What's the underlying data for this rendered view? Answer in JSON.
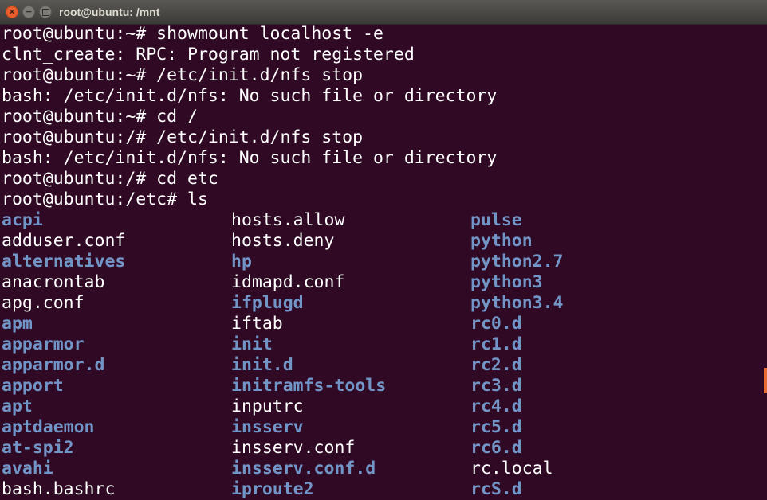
{
  "window": {
    "title": "root@ubuntu: /mnt",
    "close_glyph": "×",
    "min_glyph": "−"
  },
  "terminal": {
    "lines": [
      "root@ubuntu:~# showmount localhost -e",
      "clnt_create: RPC: Program not registered",
      "root@ubuntu:~# /etc/init.d/nfs stop",
      "bash: /etc/init.d/nfs: No such file or directory",
      "root@ubuntu:~# cd /",
      "root@ubuntu:/# /etc/init.d/nfs stop",
      "bash: /etc/init.d/nfs: No such file or directory",
      "root@ubuntu:/# cd etc",
      "root@ubuntu:/etc# ls"
    ],
    "listing": [
      [
        {
          "name": "acpi",
          "dir": true
        },
        {
          "name": "hosts.allow",
          "dir": false
        },
        {
          "name": "pulse",
          "dir": true
        }
      ],
      [
        {
          "name": "adduser.conf",
          "dir": false
        },
        {
          "name": "hosts.deny",
          "dir": false
        },
        {
          "name": "python",
          "dir": true
        }
      ],
      [
        {
          "name": "alternatives",
          "dir": true
        },
        {
          "name": "hp",
          "dir": true
        },
        {
          "name": "python2.7",
          "dir": true
        }
      ],
      [
        {
          "name": "anacrontab",
          "dir": false
        },
        {
          "name": "idmapd.conf",
          "dir": false
        },
        {
          "name": "python3",
          "dir": true
        }
      ],
      [
        {
          "name": "apg.conf",
          "dir": false
        },
        {
          "name": "ifplugd",
          "dir": true
        },
        {
          "name": "python3.4",
          "dir": true
        }
      ],
      [
        {
          "name": "apm",
          "dir": true
        },
        {
          "name": "iftab",
          "dir": false
        },
        {
          "name": "rc0.d",
          "dir": true
        }
      ],
      [
        {
          "name": "apparmor",
          "dir": true
        },
        {
          "name": "init",
          "dir": true
        },
        {
          "name": "rc1.d",
          "dir": true
        }
      ],
      [
        {
          "name": "apparmor.d",
          "dir": true
        },
        {
          "name": "init.d",
          "dir": true
        },
        {
          "name": "rc2.d",
          "dir": true
        }
      ],
      [
        {
          "name": "apport",
          "dir": true
        },
        {
          "name": "initramfs-tools",
          "dir": true
        },
        {
          "name": "rc3.d",
          "dir": true
        }
      ],
      [
        {
          "name": "apt",
          "dir": true
        },
        {
          "name": "inputrc",
          "dir": false
        },
        {
          "name": "rc4.d",
          "dir": true
        }
      ],
      [
        {
          "name": "aptdaemon",
          "dir": true
        },
        {
          "name": "insserv",
          "dir": true
        },
        {
          "name": "rc5.d",
          "dir": true
        }
      ],
      [
        {
          "name": "at-spi2",
          "dir": true
        },
        {
          "name": "insserv.conf",
          "dir": false
        },
        {
          "name": "rc6.d",
          "dir": true
        }
      ],
      [
        {
          "name": "avahi",
          "dir": true
        },
        {
          "name": "insserv.conf.d",
          "dir": true
        },
        {
          "name": "rc.local",
          "dir": false
        }
      ],
      [
        {
          "name": "bash.bashrc",
          "dir": false
        },
        {
          "name": "iproute2",
          "dir": true
        },
        {
          "name": "rcS.d",
          "dir": true
        }
      ]
    ]
  },
  "colors": {
    "background": "#300a24",
    "directory": "#7295c8",
    "text": "#ffffff",
    "close_button": "#e95d2e",
    "scrollbar": "#e46b33"
  }
}
